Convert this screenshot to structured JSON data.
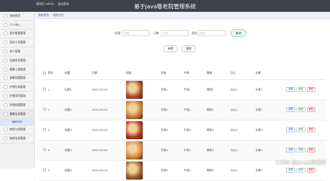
{
  "header": {
    "user_label": "管理员 admin",
    "logout_label": "退出登录",
    "title": "基于java敬老院管理系统"
  },
  "sidebar": {
    "items": [
      {
        "label": "系统首页",
        "expanded": false
      },
      {
        "label": "个人中心",
        "expanded": false
      },
      {
        "label": "医护管理管理",
        "expanded": false
      },
      {
        "label": "医护人员管理",
        "expanded": false
      },
      {
        "label": "老人管理",
        "expanded": false
      },
      {
        "label": "设施信息管理",
        "expanded": false
      },
      {
        "label": "健康上报管理",
        "expanded": false
      },
      {
        "label": "健康档案管理",
        "expanded": false
      },
      {
        "label": "护理记录管理",
        "expanded": false
      },
      {
        "label": "护理项目管理",
        "expanded": false
      },
      {
        "label": "护理档案管理",
        "expanded": false
      },
      {
        "label": "膳食信息管理",
        "expanded": true
      },
      {
        "label": "物资分类管理",
        "expanded": false
      },
      {
        "label": "物资信息管理",
        "expanded": false
      }
    ],
    "sub_item": "膳食信息"
  },
  "breadcrumb": {
    "home": "系统首页",
    "current": "膳食信息"
  },
  "search": {
    "field1_label": "标题",
    "field1_placeholder": "标题",
    "field2_label": "日期",
    "field2_placeholder": "日期",
    "field3_label": "类型",
    "field3_placeholder": "类型",
    "button_label": "查询"
  },
  "toolbar": {
    "add_label": "新增",
    "delete_label": "删除"
  },
  "table": {
    "headers": [
      "",
      "索号",
      "标题",
      "日期",
      "封面",
      "早餐",
      "午餐",
      "晚餐",
      "点心",
      "水果",
      ""
    ],
    "rows": [
      {
        "index": "1",
        "title": "标题1",
        "date": "2023-05-04",
        "breakfast": "早餐1",
        "lunch": "午餐1",
        "dinner": "晚餐1",
        "snack": "点心1",
        "fruit": "水果1",
        "img": "#a84a2a"
      },
      {
        "index": "2",
        "title": "标题2",
        "date": "2023-05-04",
        "breakfast": "早餐2",
        "lunch": "午餐2",
        "dinner": "晚餐2",
        "snack": "点心2",
        "fruit": "水果2",
        "img": "#c8792f"
      },
      {
        "index": "3",
        "title": "标题3",
        "date": "2023-05-04",
        "breakfast": "早餐3",
        "lunch": "午餐3",
        "dinner": "晚餐3",
        "snack": "点心3",
        "fruit": "水果3",
        "img": "#b3341f"
      },
      {
        "index": "4",
        "title": "标题4",
        "date": "2023-05-04",
        "breakfast": "早餐4",
        "lunch": "午餐4",
        "dinner": "晚餐4",
        "snack": "点心4",
        "fruit": "水果4",
        "img": "#d9873a"
      },
      {
        "index": "5",
        "title": "标题5",
        "date": "2023-05-04",
        "breakfast": "早餐5",
        "lunch": "午餐5",
        "dinner": "晚餐5",
        "snack": "点心5",
        "fruit": "水果5",
        "img": "#9c5a2b"
      }
    ],
    "ops": {
      "view": "详情",
      "edit": "修改",
      "delete": "删除"
    }
  },
  "watermark": "CSDN @Java大鹏老师"
}
